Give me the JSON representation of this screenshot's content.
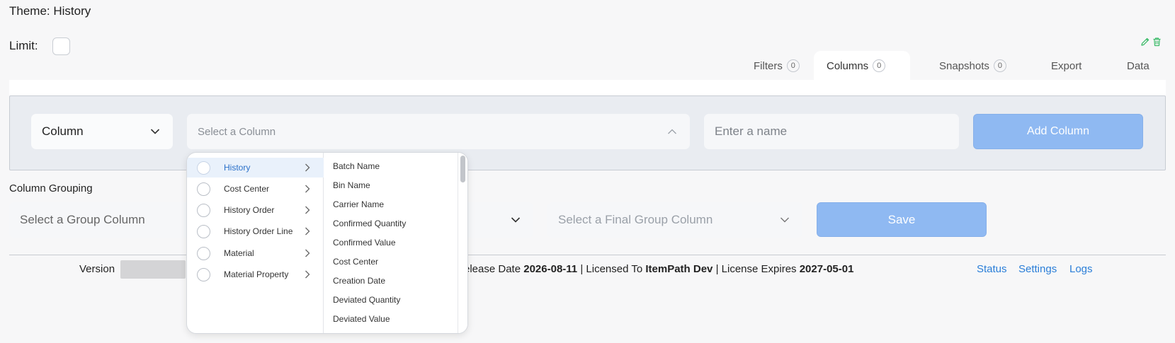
{
  "theme": {
    "title": "Theme: History"
  },
  "limit": {
    "label": "Limit:"
  },
  "tabs": [
    {
      "label": "Filters",
      "count": "0"
    },
    {
      "label": "Columns",
      "count": "0"
    },
    {
      "label": "Snapshots",
      "count": "0"
    },
    {
      "label": "Export"
    },
    {
      "label": "Data"
    }
  ],
  "column_form": {
    "type_value": "Column",
    "select_placeholder": "Select a Column",
    "name_placeholder": "Enter a name",
    "add_button": "Add Column"
  },
  "grouping": {
    "label": "Column Grouping",
    "group_placeholder": "Select a Group Column",
    "final_placeholder": "Select a Final Group Column",
    "save_button": "Save"
  },
  "dropdown": {
    "categories": [
      "History",
      "Cost Center",
      "History Order",
      "History Order Line",
      "Material",
      "Material Property"
    ],
    "columns": [
      "Batch Name",
      "Bin Name",
      "Carrier Name",
      "Confirmed Quantity",
      "Confirmed Value",
      "Cost Center",
      "Creation Date",
      "Deviated Quantity",
      "Deviated Value"
    ]
  },
  "footer": {
    "version_label": "Version",
    "release_label": "elease Date",
    "release_date": "2026-08-11",
    "licensed_label": "Licensed To",
    "licensed_to": "ItemPath Dev",
    "expires_label": "License Expires",
    "expires_date": "2027-05-01",
    "sep": "|",
    "links": [
      "Status",
      "Settings",
      "Logs"
    ]
  },
  "colors": {
    "accent": "#8fb9f2",
    "link": "#2a7ed8",
    "icon_green": "#3dbb6a"
  }
}
